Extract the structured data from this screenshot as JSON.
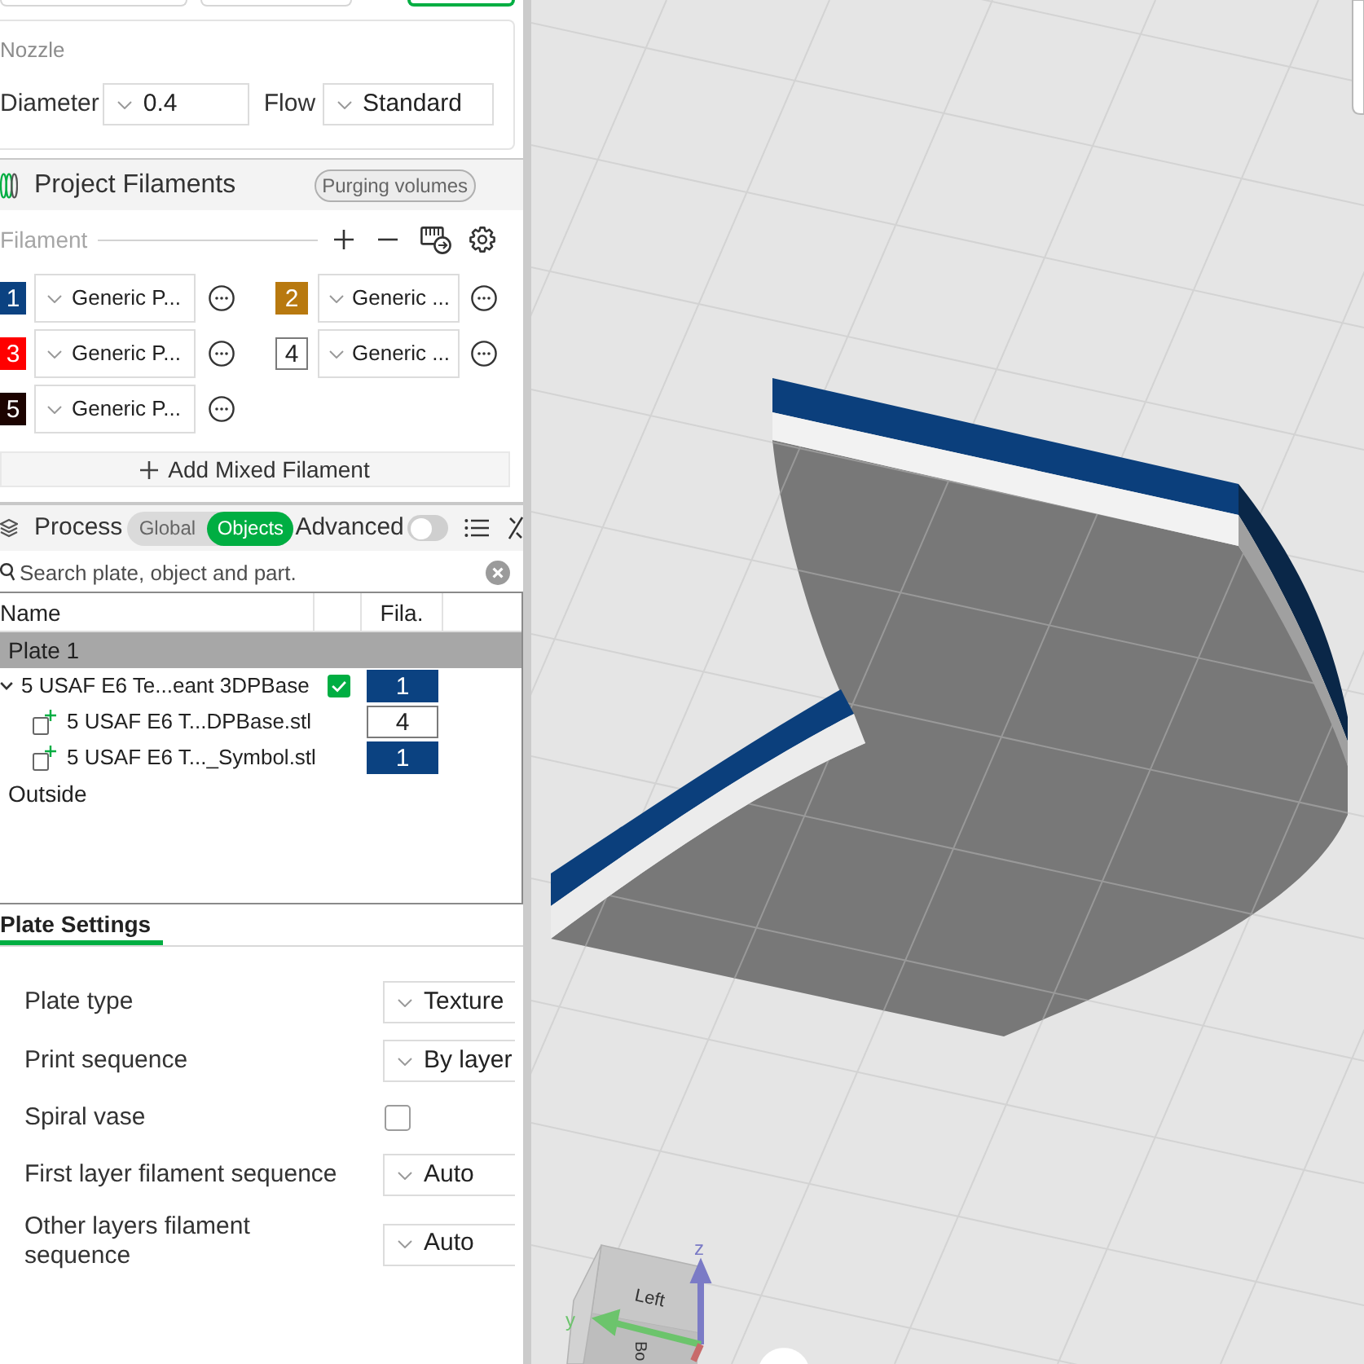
{
  "mode_buttons": [
    {
      "selected": false
    },
    {
      "selected": false
    },
    {
      "selected": true
    }
  ],
  "nozzle": {
    "title": "Nozzle",
    "fields": [
      {
        "label": "Diameter",
        "value": "0.4"
      },
      {
        "label": "Flow",
        "value": "Standard"
      }
    ]
  },
  "project_filaments": {
    "title": "Project Filaments",
    "purge_button": "Purging volumes",
    "section_label": "Filament",
    "filaments": [
      {
        "number": "1",
        "color": "#0b4281",
        "name": "Generic P..."
      },
      {
        "number": "2",
        "color": "#b8790f",
        "name": "Generic ..."
      },
      {
        "number": "3",
        "color": "#ff0000",
        "name": "Generic P..."
      },
      {
        "number": "4",
        "color": "#ffffff",
        "name": "Generic ..."
      },
      {
        "number": "5",
        "color": "#1c0300",
        "name": "Generic P..."
      }
    ],
    "add_button": "Add Mixed Filament"
  },
  "process": {
    "title": "Process",
    "scope_tabs": [
      {
        "label": "Global",
        "selected": false
      },
      {
        "label": "Objects",
        "selected": true
      }
    ],
    "advanced": {
      "label": "Advanced",
      "on": false
    }
  },
  "object_list": {
    "search": {
      "placeholder": "Search plate, object and part."
    },
    "columns": [
      "Name",
      "Fila."
    ],
    "rows": [
      {
        "kind": "plate",
        "name": "Plate 1",
        "selected": true
      },
      {
        "kind": "object",
        "name": "5 USAF E6 Te...eant 3DPBase",
        "expanded": true,
        "checked": true,
        "filament": {
          "number": "1",
          "color": "#0b4281"
        },
        "selected": false,
        "children": [
          {
            "kind": "part",
            "name": "5 USAF E6 T...DPBase.stl",
            "filament": {
              "number": "4",
              "color": "#ffffff"
            },
            "selected": false
          },
          {
            "kind": "part",
            "name": "5 USAF E6 T..._Symbol.stl",
            "filament": {
              "number": "1",
              "color": "#0b4281"
            },
            "selected": false
          }
        ]
      },
      {
        "kind": "plate",
        "name": "Outside",
        "selected": false
      }
    ]
  },
  "plate_settings": {
    "tabs": [
      {
        "label": "Plate Settings",
        "selected": true
      }
    ],
    "settings": [
      {
        "kind": "dropdown",
        "label": "Plate type",
        "value": "Texture"
      },
      {
        "kind": "dropdown",
        "label": "Print sequence",
        "value": "By layer"
      },
      {
        "kind": "checkbox",
        "label": "Spiral vase",
        "checked": false
      },
      {
        "kind": "dropdown",
        "label": "First layer filament sequence",
        "value": "Auto"
      },
      {
        "kind": "dropdown",
        "label": "Other layers filament sequence",
        "value": "Auto"
      }
    ]
  },
  "viewport": {
    "view_cube": {
      "face_labels": [
        "Left",
        "Bo"
      ]
    },
    "axes": [
      {
        "label": "z",
        "color": "#7b7bc6"
      },
      {
        "label": "y",
        "color": "#6cc46c"
      },
      {
        "color": "#c86a6a"
      }
    ]
  }
}
